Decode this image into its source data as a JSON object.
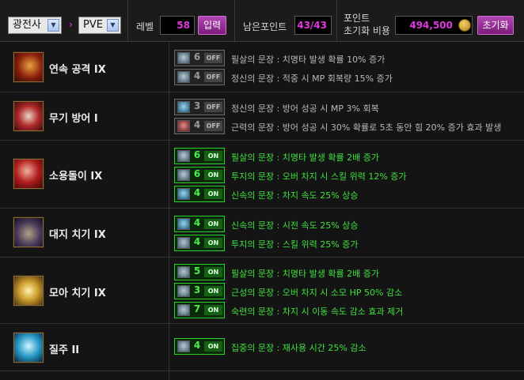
{
  "topbar": {
    "class_select": "광전사",
    "mode_select": "PVE",
    "level_label": "레벨",
    "level_value": "58",
    "enter_label": "입력",
    "remain_label": "남은포인트",
    "remain_value": "43/43",
    "reset_cost_label_1": "포인트",
    "reset_cost_label_2": "초기화 비용",
    "reset_cost_value": "494,500",
    "reset_label": "초기화",
    "chevron": "›"
  },
  "skills": [
    {
      "name": "연속 공격 IX",
      "runes": [
        {
          "level": "6",
          "state": "OFF",
          "desc": "필살의 문장 : 치명타 발생 확률 10% 증가"
        },
        {
          "level": "4",
          "state": "OFF",
          "desc": "정신의 문장 : 적중 시 MP 회복량 15% 증가"
        }
      ]
    },
    {
      "name": "무기 방어 I",
      "runes": [
        {
          "level": "3",
          "state": "OFF",
          "desc": "정신의 문장 : 방어 성공 시 MP 3% 회복"
        },
        {
          "level": "4",
          "state": "OFF",
          "desc": "근력의 문장 : 방어 성공 시 30% 확률로 5초 동안 힘 20% 증가 효과 발생"
        }
      ]
    },
    {
      "name": "소용돌이 IX",
      "runes": [
        {
          "level": "6",
          "state": "ON",
          "desc": "필살의 문장 : 치명타 발생 확률 2배 증가"
        },
        {
          "level": "6",
          "state": "ON",
          "desc": "투지의 문장 : 오버 차지 시 스킬 위력 12% 증가"
        },
        {
          "level": "4",
          "state": "ON",
          "desc": "신속의 문장 : 차지 속도 25% 상승"
        }
      ]
    },
    {
      "name": "대지 치기 IX",
      "runes": [
        {
          "level": "4",
          "state": "ON",
          "desc": "신속의 문장 : 시전 속도 25% 상승"
        },
        {
          "level": "4",
          "state": "ON",
          "desc": "투지의 문장 : 스킬 위력 25% 증가"
        }
      ]
    },
    {
      "name": "모아 치기 IX",
      "runes": [
        {
          "level": "5",
          "state": "ON",
          "desc": "필살의 문장 : 치명타 발생 확률 2배 증가"
        },
        {
          "level": "3",
          "state": "ON",
          "desc": "근성의 문장 : 오버 차지 시 소모 HP 50% 감소"
        },
        {
          "level": "7",
          "state": "ON",
          "desc": "숙련의 문장 : 차지 시 이동 속도 감소 효과 제거"
        }
      ]
    },
    {
      "name": "질주 II",
      "runes": [
        {
          "level": "4",
          "state": "ON",
          "desc": "집중의 문장 : 재사용 시간 25% 감소"
        }
      ]
    }
  ],
  "colors": {
    "accent": "#e038e0",
    "on_green": "#3fe23f",
    "off_gray": "#9a9a9a"
  },
  "icons": [
    "dropdown-arrow-icon",
    "chevron-right-icon",
    "gold-coin-icon",
    "skill-icon",
    "rune-icon"
  ]
}
